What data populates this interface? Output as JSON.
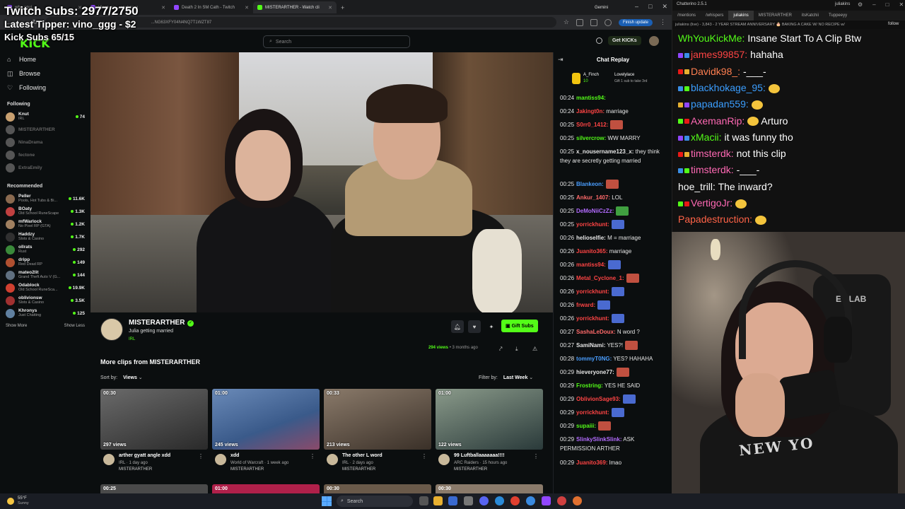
{
  "overlay": {
    "subs": "Twitch Subs: 2977/2750",
    "tipper": "Latest Tipper: vino_ggg - $2",
    "kick": "Kick Subs 65/15"
  },
  "browser": {
    "tabs": [
      {
        "label": "who ogui...",
        "color": "#9146ff",
        "active": false
      },
      {
        "label": "Vince as ... ceeban u",
        "color": "#9146ff",
        "active": false
      },
      {
        "label": "Death 2 In SM Cath - Twitch",
        "color": "#9146ff",
        "active": false
      },
      {
        "label": "MISTERARTHER - Watch cli",
        "color": "#53fc18",
        "active": true
      }
    ],
    "gemini": "Gemini",
    "address": "...NG63XFY04N4NQ7T1WZT87",
    "finish_update": "Finish update"
  },
  "kick": {
    "logo": "KICK",
    "search_placeholder": "Search",
    "get_kicks": "Get KICKs",
    "nav": [
      {
        "label": "Home",
        "icon": "home-icon",
        "glyph": "⌂"
      },
      {
        "label": "Browse",
        "icon": "browse-icon",
        "glyph": "◫"
      },
      {
        "label": "Following",
        "icon": "heart-icon",
        "glyph": "♡"
      }
    ],
    "following_title": "Following",
    "following": [
      {
        "name": "Knut",
        "cat": "IRL",
        "views": "74",
        "color": "#c8a070",
        "live": true
      },
      {
        "name": "MISTERARTHER",
        "cat": "",
        "views": "",
        "color": "#555",
        "live": false
      },
      {
        "name": "NinaDrama",
        "cat": "",
        "views": "",
        "color": "#555",
        "live": false
      },
      {
        "name": "fectone",
        "cat": "",
        "views": "",
        "color": "#555",
        "live": false
      },
      {
        "name": "ExtraEmily",
        "cat": "",
        "views": "",
        "color": "#555",
        "live": false
      }
    ],
    "recommended_title": "Recommended",
    "recommended": [
      {
        "name": "Peller",
        "cat": "Pools, Hot Tubs & Bi...",
        "views": "11.6K",
        "color": "#8a6a50"
      },
      {
        "name": "BOaty",
        "cat": "Old School RuneScape",
        "views": "1.3K",
        "color": "#c04040"
      },
      {
        "name": "mfWarlock",
        "cat": "No Pixel RP (GTA)",
        "views": "1.2K",
        "color": "#a08060"
      },
      {
        "name": "Haddzy",
        "cat": "Slots & Casino",
        "views": "1.7K",
        "color": "#303030"
      },
      {
        "name": "ollrats",
        "cat": "Rust",
        "views": "292",
        "color": "#3a8a3a"
      },
      {
        "name": "dripp",
        "cat": "Red Dead RP",
        "views": "149",
        "color": "#b05030"
      },
      {
        "name": "mateo2lit",
        "cat": "Grand Theft Auto V (G...",
        "views": "144",
        "color": "#607080"
      },
      {
        "name": "Odablock",
        "cat": "Old School RuneSca...",
        "views": "19.9K",
        "color": "#d04030"
      },
      {
        "name": "oblivionsw",
        "cat": "Slots & Casino",
        "views": "3.5K",
        "color": "#a03030"
      },
      {
        "name": "Khronys",
        "cat": "Just Chatting",
        "views": "125",
        "color": "#6080a0"
      }
    ],
    "show_more": "Show More",
    "show_less": "Show Less",
    "clip": {
      "streamer": "MISTERARTHER",
      "title": "Julia getting married",
      "category": "IRL",
      "gift_subs": "Gift Subs",
      "views": "294 views",
      "age": "• 3 months ago"
    },
    "more_clips_title": "More clips from MISTERARTHER",
    "sort_label": "Sort by:",
    "sort_value": "Views",
    "filter_label": "Filter by:",
    "filter_value": "Last Week",
    "clips": [
      {
        "dur": "00:30",
        "views": "297 views",
        "title": "arther gyatt angle xdd",
        "meta": "IRL · 1 day ago",
        "by": "MISTERARTHER",
        "bg": "linear-gradient(160deg,#6a6a6a,#2a2a2a)"
      },
      {
        "dur": "01:00",
        "views": "245 views",
        "title": "xdd",
        "meta": "World of Warcraft · 1 week ago",
        "by": "MISTERARTHER",
        "bg": "linear-gradient(160deg,#6a8ab8,#3a5a8a 60%,#8a4a6a)"
      },
      {
        "dur": "00:33",
        "views": "213 views",
        "title": "The other L word",
        "meta": "IRL · 2 days ago",
        "by": "MISTERARTHER",
        "bg": "linear-gradient(160deg,#8a7a6a,#3a3028)"
      },
      {
        "dur": "01:00",
        "views": "122 views",
        "title": "99 Luftballaaaaaaa!!!!",
        "meta": "ARC Raiders · 15 hours ago",
        "by": "MISTERARTHER",
        "bg": "linear-gradient(160deg,#8a9a8a,#2a3a3a)"
      }
    ],
    "clips_row2": [
      {
        "dur": "00:25",
        "bg": "#4a4a4a"
      },
      {
        "dur": "01:00",
        "bg": "#b0204a"
      },
      {
        "dur": "00:30",
        "bg": "#6a5a4a"
      },
      {
        "dur": "00:30",
        "bg": "#8a7a6a"
      }
    ]
  },
  "chat_replay": {
    "title": "Chat Replay",
    "gift_user1": "A_Finch",
    "gift_count": "10",
    "gift_user2": "Lovelylace",
    "gift_cta": "Gift 1 sub to take 3rd",
    "messages": [
      {
        "t": "00:24",
        "u": "mantiss94:",
        "c": "#53fc18",
        "m": ""
      },
      {
        "t": "00:24",
        "u": "Jakingt0n:",
        "c": "#ff4444",
        "m": "marriage"
      },
      {
        "t": "00:25",
        "u": "S0rr0_1412:",
        "c": "#ff4444",
        "m": "",
        "emo": "#c05040"
      },
      {
        "t": "00:25",
        "u": "silvercrow:",
        "c": "#53fc18",
        "m": "WW MARRY"
      },
      {
        "t": "00:25",
        "u": "x_nousername123_x:",
        "c": "#e6e6e6",
        "m": "they think they are secretly getting married"
      },
      {
        "t": "00:25",
        "u": "Blankeon:",
        "c": "#4a9eff",
        "m": "",
        "emo": "#c05040"
      },
      {
        "t": "00:25",
        "u": "Ankur_1407:",
        "c": "#ff6a6a",
        "m": "LOL"
      },
      {
        "t": "00:25",
        "u": "DeMoNiiCzZz:",
        "c": "#b36bff",
        "m": "",
        "emo": "#40a040"
      },
      {
        "t": "00:25",
        "u": "yorrickhunt:",
        "c": "#ff4444",
        "m": "",
        "emo": "#4a6ad0"
      },
      {
        "t": "00:26",
        "u": "helioselfie:",
        "c": "#e6e6e6",
        "m": "M = marriage"
      },
      {
        "t": "00:26",
        "u": "Juanito365:",
        "c": "#ff4444",
        "m": "marriage"
      },
      {
        "t": "00:26",
        "u": "mantiss94:",
        "c": "#ff4444",
        "m": "",
        "emo": "#4a6ad0"
      },
      {
        "t": "00:26",
        "u": "Metal_Cyclone_1:",
        "c": "#ff4444",
        "m": "",
        "emo": "#c05040"
      },
      {
        "t": "00:26",
        "u": "yorrickhunt:",
        "c": "#ff4444",
        "m": "",
        "emo": "#4a6ad0"
      },
      {
        "t": "00:26",
        "u": "frward:",
        "c": "#ff4444",
        "m": "",
        "emo": "#4a6ad0"
      },
      {
        "t": "00:26",
        "u": "yorrickhunt:",
        "c": "#ff4444",
        "m": "",
        "emo": "#4a6ad0"
      },
      {
        "t": "00:27",
        "u": "SashaLeDoux:",
        "c": "#ff6a6a",
        "m": "N word ?"
      },
      {
        "t": "00:27",
        "u": "SamiNami:",
        "c": "#e6e6e6",
        "m": "YES?!",
        "emo": "#c05040"
      },
      {
        "t": "00:28",
        "u": "tommyT0NG:",
        "c": "#4a9eff",
        "m": "YES? HAHAHA"
      },
      {
        "t": "00:29",
        "u": "hieveryone77:",
        "c": "#e6e6e6",
        "m": "",
        "emo": "#c05040"
      },
      {
        "t": "00:29",
        "u": "Frostring:",
        "c": "#53fc18",
        "m": "YES HE SAID"
      },
      {
        "t": "00:29",
        "u": "OblivionSage93:",
        "c": "#ff4444",
        "m": "",
        "emo": "#4a6ad0"
      },
      {
        "t": "00:29",
        "u": "yorrickhunt:",
        "c": "#ff4444",
        "m": "",
        "emo": "#4a6ad0"
      },
      {
        "t": "00:29",
        "u": "supaiii:",
        "c": "#53fc18",
        "m": "",
        "emo": "#c05040"
      },
      {
        "t": "00:29",
        "u": "SlinkySlinkSlink:",
        "c": "#b36bff",
        "m": "ASK PERMISSION ARTHER"
      },
      {
        "t": "00:29",
        "u": "Juanito369:",
        "c": "#ff4444",
        "m": "lmao"
      }
    ]
  },
  "chatterino": {
    "title": "Chatterino 2.5.1",
    "user": "juliakins",
    "tabs": [
      "/mentions",
      "/whispers",
      "juliakins",
      "MISTERARTHER",
      "itsKatchii",
      "Tuppeeyy"
    ],
    "active_tab": 2,
    "info": "juliakins (live) - 3,843 - 2 YEAR STREAM ANNIVERSARY 🎂 BAKING A CAKE W/ NO RECIPE w/",
    "follow": "follow",
    "messages": [
      {
        "u": "WhYouKickMe:",
        "c": "#53fc18",
        "m": "Insane Start To A Clip Btw",
        "emo": false
      },
      {
        "u": "james99857:",
        "c": "#ff4444",
        "m": "hahaha",
        "emo": false
      },
      {
        "u": "Davidk98_:",
        "c": "#ff7f50",
        "m": "-___-",
        "emo": false
      },
      {
        "u": "blackhokage_95:",
        "c": "#3b9eff",
        "m": "",
        "emo": true
      },
      {
        "u": "papadan559:",
        "c": "#3b9eff",
        "m": "",
        "emo": true
      },
      {
        "u": "AxemanRip:",
        "c": "#ff69b4",
        "m": "Arturo",
        "emo": true
      },
      {
        "u": "xMacii:",
        "c": "#53fc18",
        "m": "it was funny tho",
        "emo": false
      },
      {
        "u": "timsterdk:",
        "c": "#ff69b4",
        "m": "not this clip",
        "emo": false
      },
      {
        "u": "timsterdk:",
        "c": "#ff69b4",
        "m": "-___-",
        "emo": false
      },
      {
        "u": "hoe_trill:",
        "c": "#ffffff",
        "m": "The inward?",
        "emo": false
      },
      {
        "u": "VertigoJr:",
        "c": "#ff69b4",
        "m": "",
        "emo": true
      },
      {
        "u": "Papadestruction:",
        "c": "#ff6347",
        "m": "",
        "emo": true
      }
    ]
  },
  "webcam": {
    "shirt_text": "NEW YO",
    "sign_text": "ET LAB"
  },
  "taskbar": {
    "temp": "55°F",
    "weather": "Sunny",
    "search": "Search"
  }
}
